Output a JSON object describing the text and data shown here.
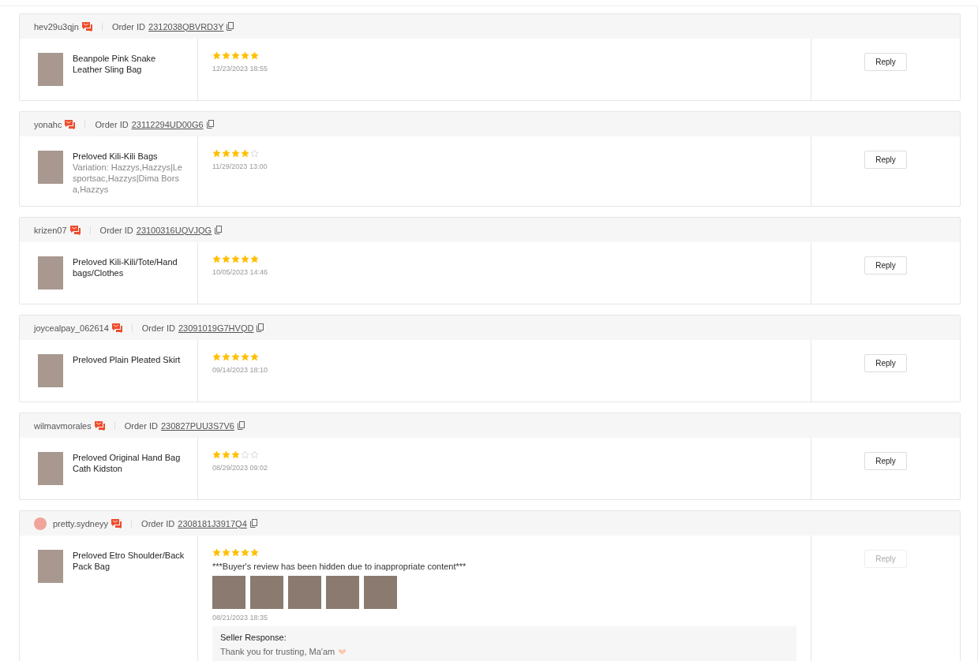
{
  "reviews": [
    {
      "buyer": "hev29u3qjn",
      "avatar": false,
      "order_label": "Order ID",
      "order_id": "2312038QBVRD3Y",
      "product": "Beanpole Pink Snake Leather Sling Bag",
      "stars": 5,
      "date": "12/23/2023 18:55",
      "reply": {
        "label": "Reply",
        "disabled": false
      }
    },
    {
      "buyer": "yonahc",
      "avatar": false,
      "order_label": "Order ID",
      "order_id": "23112294UD00G6",
      "product": "Preloved Kili-Kili Bags",
      "variation": "Variation: Hazzys,Hazzys|Lesportsac,Hazzys|Dima Borsa,Hazzys",
      "stars": 4,
      "date": "11/29/2023 13:00",
      "reply": {
        "label": "Reply",
        "disabled": false
      }
    },
    {
      "buyer": "krizen07",
      "avatar": false,
      "order_label": "Order ID",
      "order_id": "23100316UQVJQG",
      "product": "Preloved Kili-Kili/Tote/Hand bags/Clothes",
      "stars": 5,
      "date": "10/05/2023 14:46",
      "reply": {
        "label": "Reply",
        "disabled": false
      }
    },
    {
      "buyer": "joycealpay_062614",
      "avatar": false,
      "order_label": "Order ID",
      "order_id": "23091019G7HVQD",
      "product": "Preloved Plain Pleated Skirt",
      "stars": 5,
      "date": "09/14/2023 18:10",
      "reply": {
        "label": "Reply",
        "disabled": false
      }
    },
    {
      "buyer": "wilmavmorales",
      "avatar": false,
      "order_label": "Order ID",
      "order_id": "230827PUU3S7V6",
      "product": "Preloved Original Hand Bag Cath Kidston",
      "stars": 3,
      "date": "08/29/2023 09:02",
      "reply": {
        "label": "Reply",
        "disabled": false
      }
    },
    {
      "buyer": "pretty.sydneyy",
      "avatar": true,
      "order_label": "Order ID",
      "order_id": "2308181J3917Q4",
      "product": "Preloved Etro Shoulder/Back Pack Bag",
      "stars": 5,
      "review": "***Buyer's review has been hidden due to inappropriate content***",
      "photos": [
        {
          "kind": "photo"
        },
        {
          "kind": "photo"
        },
        {
          "kind": "photo"
        },
        {
          "kind": "photo"
        },
        {
          "kind": "photo"
        }
      ],
      "date": "08/21/2023 18:35",
      "seller_response": {
        "title": "Seller Response:",
        "text": "Thank you for trusting, Ma'am"
      },
      "reply": {
        "label": "Reply",
        "disabled": true
      }
    }
  ]
}
